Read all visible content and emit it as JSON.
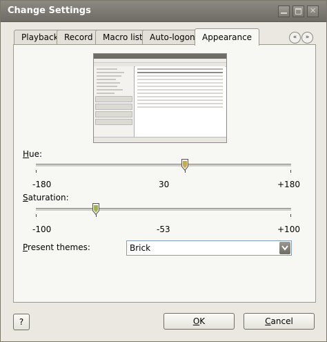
{
  "window": {
    "title": "Change Settings"
  },
  "tabs": [
    {
      "label": "Playback"
    },
    {
      "label": "Record"
    },
    {
      "label": "Macro list"
    },
    {
      "label": "Auto-logon"
    },
    {
      "label": "Appearance"
    }
  ],
  "active_tab": "Appearance",
  "hue": {
    "label_first": "H",
    "label_rest": "ue:",
    "value": 30,
    "min_label": "-180",
    "mid_label": "30",
    "max_label": "+180"
  },
  "saturation": {
    "label_first": "S",
    "label_rest": "aturation:",
    "value": -53,
    "min_label": "-100",
    "mid_label": "-53",
    "max_label": "+100"
  },
  "themes": {
    "label_first": "P",
    "label_rest": "resent themes:",
    "selected": "Brick"
  },
  "buttons": {
    "help": "?",
    "ok_first": "O",
    "ok_rest": "K",
    "cancel_first": "C",
    "cancel_rest": "ancel"
  },
  "icons": {
    "prev": "chevron-double-left-icon",
    "next": "chevron-double-right-icon",
    "dropdown": "chevron-down-icon"
  }
}
